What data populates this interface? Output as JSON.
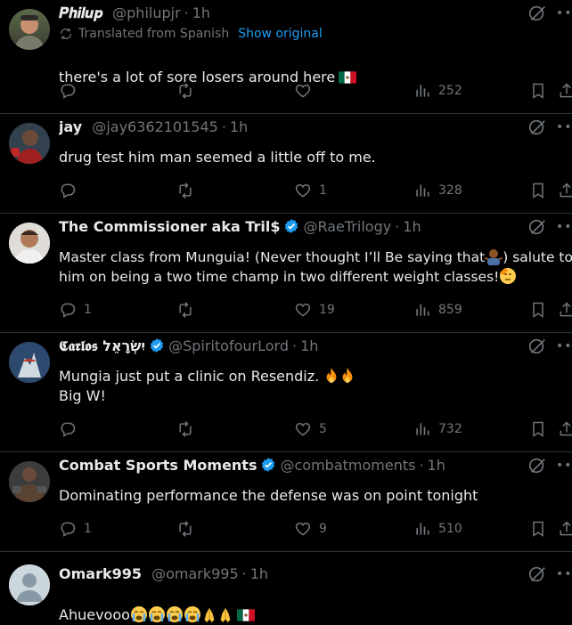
{
  "posts": [
    {
      "name": "𝑷𝒉𝒊𝒍𝒖𝒑",
      "handle": "@philupjr",
      "time": "1h",
      "verified": false,
      "translated_note": "Translated from Spanish",
      "show_original": "Show original",
      "text": "there's a lot of sore losers around here",
      "emoji_suffix": [
        "flag-mexico"
      ],
      "replies": "",
      "likes": "",
      "views": "252"
    },
    {
      "name": "jay",
      "handle": "@jay6362101545",
      "time": "1h",
      "verified": false,
      "text": "drug test him man seemed a little off to me.",
      "replies": "",
      "likes": "1",
      "views": "328"
    },
    {
      "name": "The Commissioner aka Tril$",
      "handle": "@RaeTrilogy",
      "time": "1h",
      "verified": true,
      "text_line1_a": "Master class from Munguia! (Never thought I’ll Be saying that",
      "text_line1_b": ") salute to",
      "text_line2": "him on being a two time champ in two different weight classes!",
      "replies": "1",
      "likes": "19",
      "views": "859"
    },
    {
      "name": "𝕮𝖆𝖗𝖑𝖔𝖘 יִשְׂרָאֵל",
      "handle": "@SpiritofourLord",
      "time": "1h",
      "verified": true,
      "text_line1": "Mungia just put a clinic on Resendiz.",
      "text_line2": "Big W!",
      "replies": "",
      "likes": "5",
      "views": "732"
    },
    {
      "name": "Combat Sports Moments",
      "handle": "@combatmoments",
      "time": "1h",
      "verified": true,
      "text": "Dominating performance the defense was on point tonight",
      "replies": "1",
      "likes": "9",
      "views": "510"
    },
    {
      "name": "Omark995",
      "handle": "@omark995",
      "time": "1h",
      "verified": false,
      "text": "Ahuevooo"
    }
  ],
  "colors": {
    "background": "#000000",
    "text": "#e7e9ea",
    "muted": "#71767b",
    "link": "#1d9bf0",
    "border": "#2f3336"
  },
  "icons": [
    "reply-icon",
    "retweet-icon",
    "like-icon",
    "views-icon",
    "bookmark-icon",
    "share-icon",
    "grok-icon",
    "more-icon",
    "verified-badge-icon",
    "translate-icon"
  ]
}
